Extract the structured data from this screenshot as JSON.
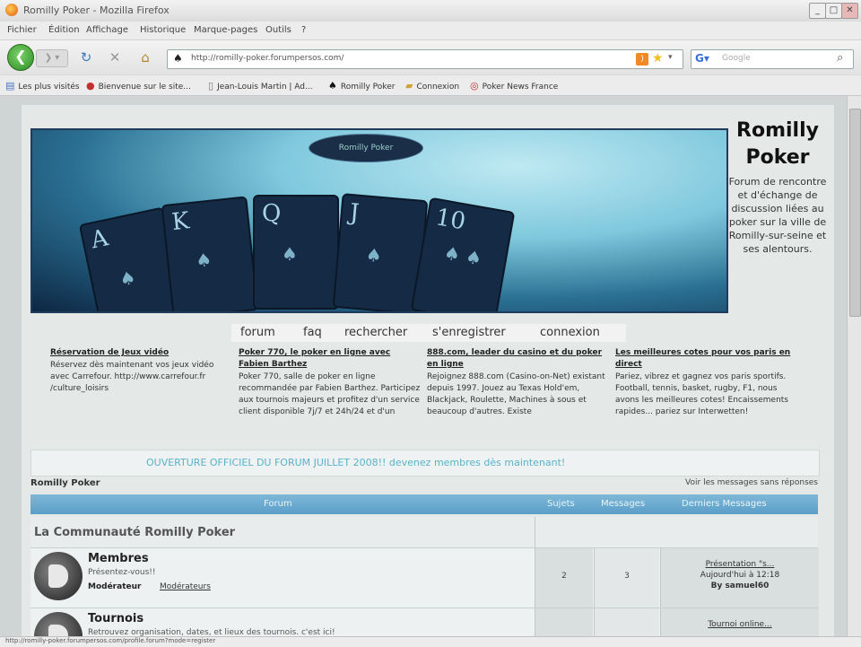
{
  "window": {
    "title": "Romilly Poker - Mozilla Firefox"
  },
  "menu": [
    "Fichier",
    "Édition",
    "Affichage",
    "Historique",
    "Marque-pages",
    "Outils",
    "?"
  ],
  "navigation": {
    "url": "http://romilly-poker.forumpersos.com/",
    "search_placeholder": "Google"
  },
  "bookmarks": [
    "Les plus visités",
    "Bienvenue sur le site...",
    "Jean-Louis Martin | Ad...",
    "Romilly Poker",
    "Connexion",
    "Poker News France"
  ],
  "site": {
    "name_line1": "Romilly",
    "name_line2": "Poker",
    "description": "Forum de rencontre et d'échange de discussion liées au poker sur la ville de Romilly-sur-seine et ses alentours.",
    "banner_logo": "Romilly Poker",
    "cards": [
      "A",
      "K",
      "Q",
      "J",
      "10"
    ]
  },
  "topnav": [
    "forum",
    "faq",
    "rechercher",
    "s'enregistrer",
    "connexion"
  ],
  "ads": [
    {
      "title": "Réservation de Jeux vidéo",
      "body": "Réservez dès maintenant vos jeux vidéo avec Carrefour. http://www.carrefour.fr /culture_loisirs"
    },
    {
      "title": "Poker 770, le poker en ligne avec Fabien Barthez",
      "body": "Poker 770, salle de poker en ligne recommandée par Fabien Barthez. Participez aux tournois majeurs et profitez d'un service client disponible 7j/7 et 24h/24 et d'un"
    },
    {
      "title": "888.com, leader du casino et du poker en ligne",
      "body": "Rejoignez 888.com (Casino-on-Net) existant depuis 1997. Jouez au Texas Hold'em, Blackjack, Roulette, Machines à sous et beaucoup d'autres. Existe"
    },
    {
      "title": "Les meilleures cotes pour vos paris en direct",
      "body": "Pariez, vibrez et gagnez vos paris sportifs. Football, tennis, basket, rugby, F1, nous avons les meilleures cotes! Encaissements rapides... pariez sur Interwetten!"
    }
  ],
  "announcement": "OUVERTURE OFFICIEL DU FORUM JUILLET 2008!! devenez membres dès maintenant!",
  "crumb": {
    "left": "Romilly Poker",
    "right": "Voir les messages sans réponses"
  },
  "table_head": [
    "Forum",
    "Sujets",
    "Messages",
    "Derniers Messages"
  ],
  "category": "La Communauté Romilly Poker",
  "forums": [
    {
      "name": "Membres",
      "desc": "Présentez-vous!!",
      "mod_label": "Modérateur",
      "mod": "Modérateurs",
      "topics": "2",
      "posts": "3",
      "last1": "Présentation \"s...",
      "last2": "Aujourd'hui à 12:18",
      "last3": "By samuel60"
    },
    {
      "name": "Tournois",
      "desc": "Retrouvez organisation, dates, et lieux des tournois. c'est ici!",
      "mod_label": "",
      "mod": "",
      "topics": "",
      "posts": "",
      "last1": "Tournoi online...",
      "last2": "",
      "last3": ""
    }
  ],
  "status": "http://romilly-poker.forumpersos.com/profile.forum?mode=register"
}
